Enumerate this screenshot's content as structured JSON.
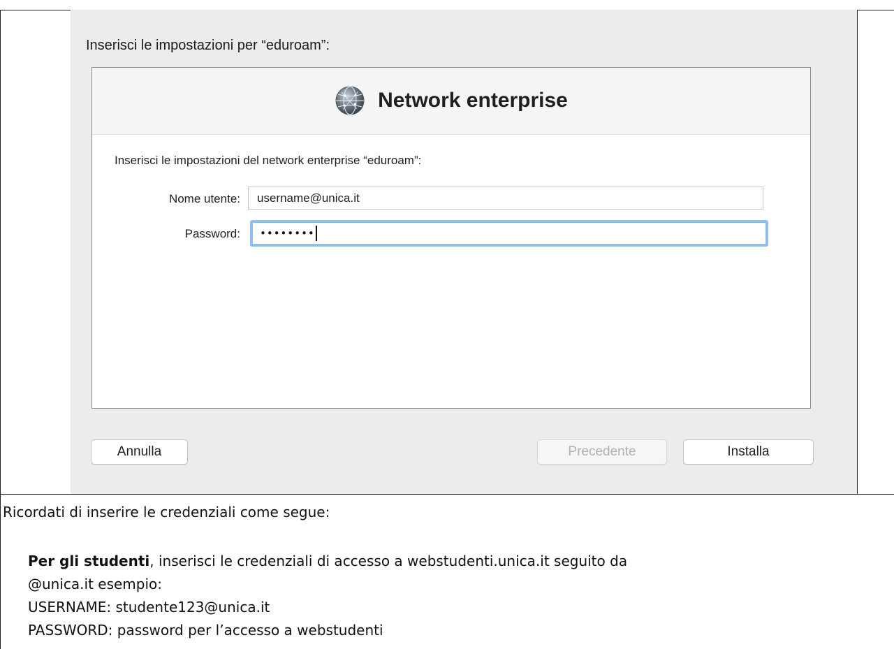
{
  "dialog": {
    "prompt": "Inserisci le impostazioni per “eduroam”:",
    "panel": {
      "icon": "globe-network-icon",
      "title": "Network enterprise",
      "subtitle": "Inserisci le impostazioni del network enterprise “eduroam”:",
      "username_label": "Nome utente:",
      "username_value": "username@unica.it",
      "password_label": "Password:",
      "password_value": "••••••••"
    },
    "buttons": {
      "cancel": "Annulla",
      "previous": "Precedente",
      "install": "Installa"
    }
  },
  "note": {
    "intro": "Ricordati di inserire le credenziali come segue:",
    "students_bold": "Per gli studenti",
    "students_text": ", inserisci le credenziali di accesso a webstudenti.unica.it seguito da",
    "students_line2": "@unica.it esempio:",
    "username_example": "USERNAME: studente123@unica.it",
    "password_example": "PASSWORD: password per l’accesso a webstudenti"
  }
}
